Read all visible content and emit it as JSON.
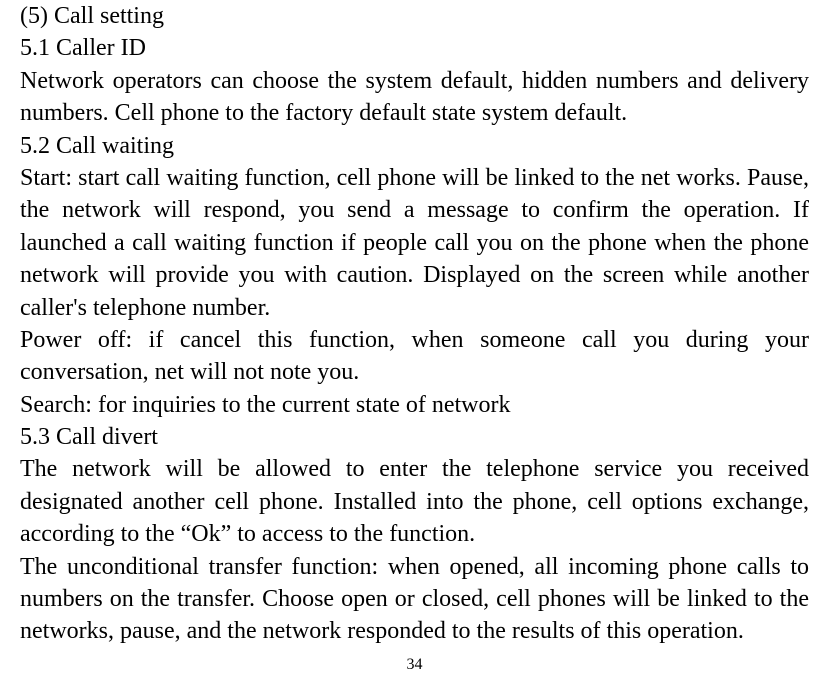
{
  "section_heading": "(5) Call setting",
  "sub1_heading": "5.1 Caller ID",
  "sub1_body": "Network operators can choose the system default, hidden numbers and delivery numbers. Cell phone to the factory default state system default.",
  "sub2_heading": "5.2 Call waiting",
  "sub2_body1": "Start: start call waiting function, cell phone will be linked to the net works. Pause, the network will respond, you send a message to confirm the operation. If launched a call waiting function if people call you on the phone when the phone network will provide you with caution. Displayed on the screen while another caller's telephone number.",
  "sub2_body2": "Power off: if cancel this function, when someone call you during your conversation, net will not note you.",
  "sub2_body3": "Search: for inquiries to the current state of network",
  "sub3_heading": "5.3 Call divert",
  "sub3_body1": "The network will be allowed to enter the telephone service you received designated another cell phone. Installed into the phone, cell options exchange, according to the “Ok” to access to the function.",
  "sub3_body2": "The unconditional transfer function: when opened, all incoming phone calls to numbers on the transfer. Choose open or closed, cell phones will be linked to the networks, pause, and the network responded to the results of this operation.",
  "page_number": "34"
}
